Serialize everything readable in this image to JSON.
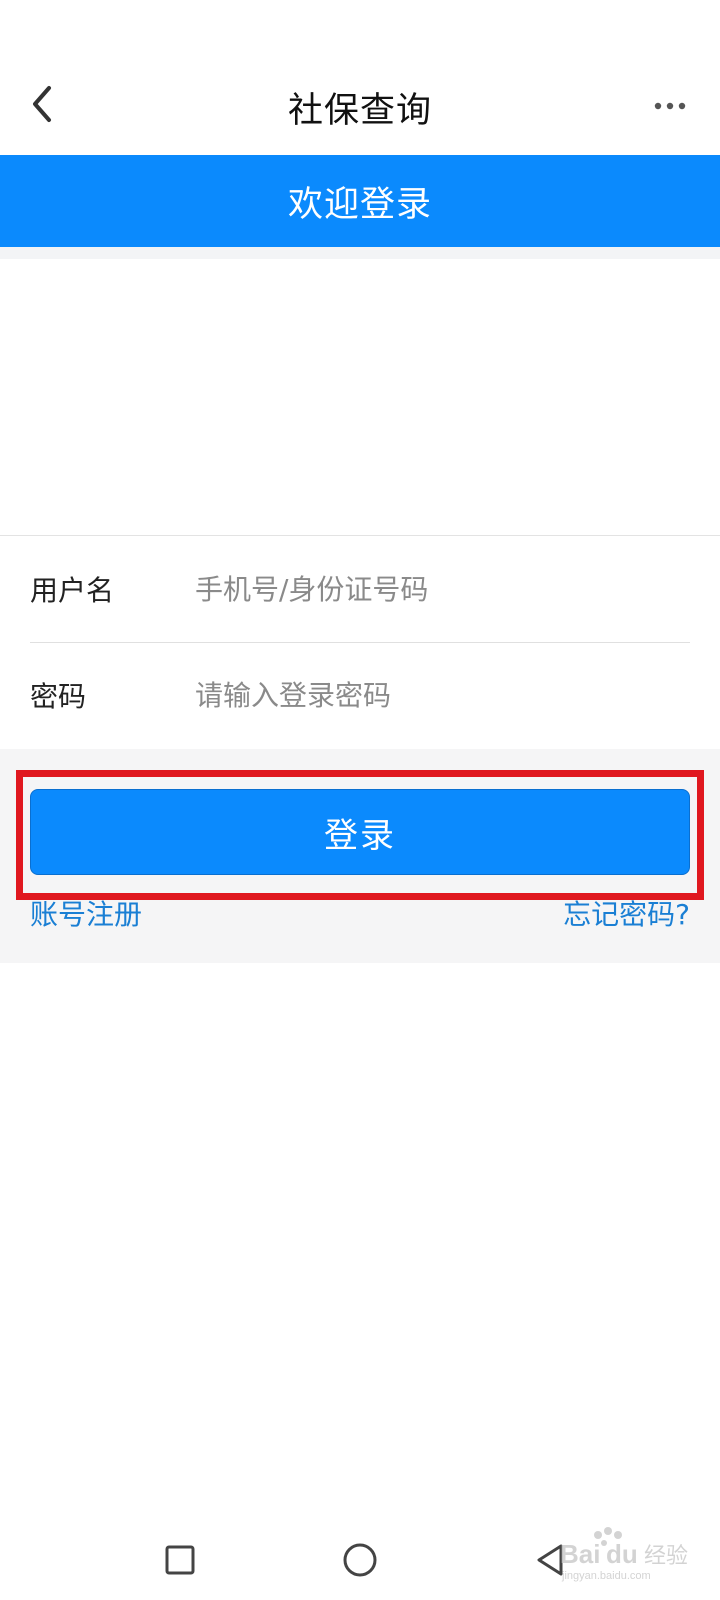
{
  "app_bar": {
    "title": "社保查询"
  },
  "banner": {
    "title": "欢迎登录"
  },
  "form": {
    "username_label": "用户名",
    "username_placeholder": "手机号/身份证号码",
    "username_value": "",
    "password_label": "密码",
    "password_placeholder": "请输入登录密码",
    "password_value": ""
  },
  "actions": {
    "login_label": "登录",
    "register_label": "账号注册",
    "forgot_label": "忘记密码?"
  },
  "colors": {
    "accent": "#0b8afd",
    "link": "#1a7fd4",
    "highlight": "#e0181f"
  },
  "icons": {
    "back": "chevron-left-icon",
    "more": "more-horizontal-icon",
    "nav_recent": "square-icon",
    "nav_home": "circle-icon",
    "nav_back": "triangle-left-icon"
  }
}
